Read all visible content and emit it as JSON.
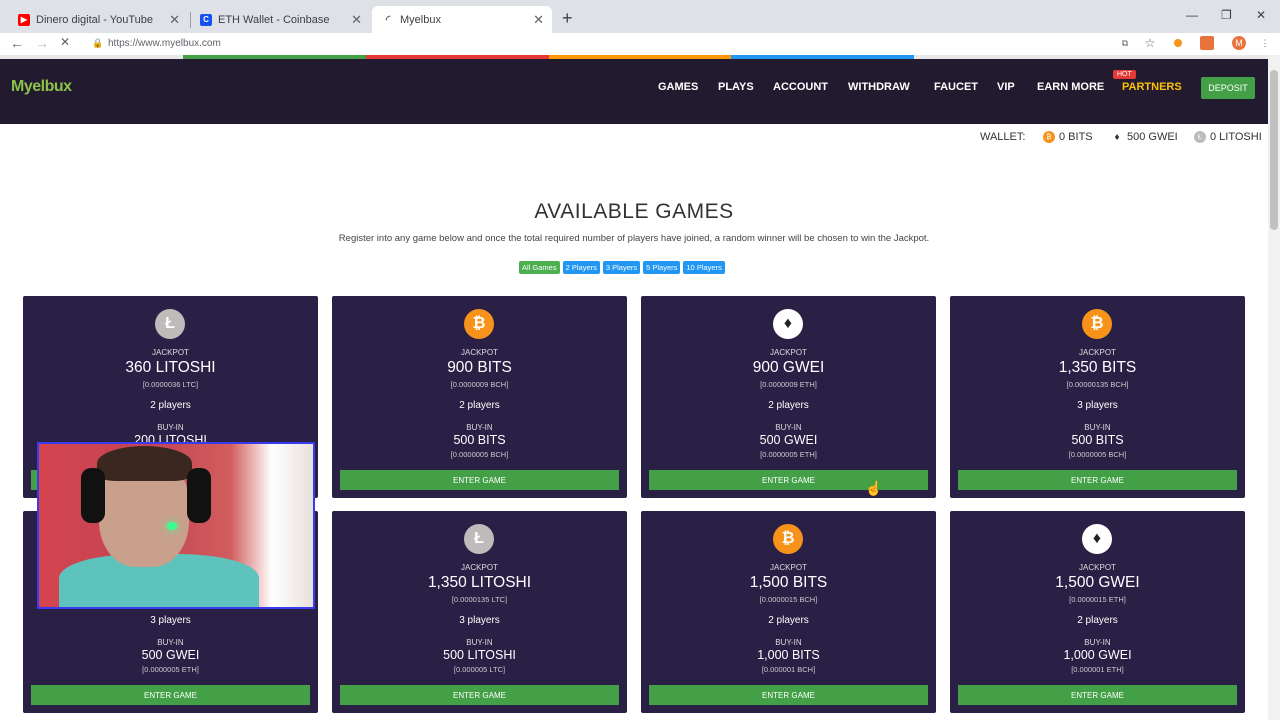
{
  "browser": {
    "tabs": [
      {
        "title": "Dinero digital - YouTube",
        "favicon_color": "#ff0000"
      },
      {
        "title": "ETH Wallet - Coinbase",
        "favicon_color": "#1652f0",
        "favicon_letter": "C"
      },
      {
        "title": "Myelbux",
        "loading": true
      }
    ],
    "url": "https://www.myelbux.com"
  },
  "header": {
    "logo": "Myelbux",
    "nav": [
      "GAMES",
      "PLAYS",
      "ACCOUNT",
      "WITHDRAW",
      "FAUCET",
      "VIP",
      "EARN MORE",
      "PARTNERS"
    ],
    "hot_badge": "HOT",
    "deposit": "DEPOSIT"
  },
  "wallet": {
    "label": "WALLET:",
    "bits": "0 BITS",
    "gwei": "500 GWEI",
    "litoshi": "0 LITOSHI"
  },
  "main": {
    "title": "AVAILABLE GAMES",
    "subtitle": "Register into any game below and once the total required number of players have joined, a random winner will be chosen to win the Jackpot.",
    "filters": [
      "All Games",
      "2 Players",
      "3 Players",
      "5 Players",
      "10 Players"
    ]
  },
  "cards": [
    {
      "coin": "ltc",
      "jackpot_label": "JACKPOT",
      "jackpot": "360 LITOSHI",
      "jackpot_sub": "[0.0000036 LTC]",
      "players": "2 players",
      "buyin_label": "BUY-IN",
      "buyin": "200 LITOSHI",
      "buyin_sub": "",
      "enter": "ENTER GAME"
    },
    {
      "coin": "btc",
      "jackpot_label": "JACKPOT",
      "jackpot": "900 BITS",
      "jackpot_sub": "[0.0000009 BCH]",
      "players": "2 players",
      "buyin_label": "BUY-IN",
      "buyin": "500 BITS",
      "buyin_sub": "[0.0000005 BCH]",
      "enter": "ENTER GAME"
    },
    {
      "coin": "eth",
      "jackpot_label": "JACKPOT",
      "jackpot": "900 GWEI",
      "jackpot_sub": "[0.0000009 ETH]",
      "players": "2 players",
      "buyin_label": "BUY-IN",
      "buyin": "500 GWEI",
      "buyin_sub": "[0.0000005 ETH]",
      "enter": "ENTER GAME"
    },
    {
      "coin": "btc",
      "jackpot_label": "JACKPOT",
      "jackpot": "1,350 BITS",
      "jackpot_sub": "[0.00000135 BCH]",
      "players": "3 players",
      "buyin_label": "BUY-IN",
      "buyin": "500 BITS",
      "buyin_sub": "[0.0000005 BCH]",
      "enter": "ENTER GAME"
    },
    {
      "coin": "eth",
      "jackpot_label": "",
      "jackpot": "",
      "jackpot_sub": "",
      "players": "3 players",
      "buyin_label": "BUY-IN",
      "buyin": "500 GWEI",
      "buyin_sub": "[0.0000005 ETH]",
      "enter": "ENTER GAME"
    },
    {
      "coin": "ltc",
      "jackpot_label": "JACKPOT",
      "jackpot": "1,350 LITOSHI",
      "jackpot_sub": "[0.0000135 LTC]",
      "players": "3 players",
      "buyin_label": "BUY-IN",
      "buyin": "500 LITOSHI",
      "buyin_sub": "[0.000005 LTC]",
      "enter": "ENTER GAME"
    },
    {
      "coin": "btc",
      "jackpot_label": "JACKPOT",
      "jackpot": "1,500 BITS",
      "jackpot_sub": "[0.0000015 BCH]",
      "players": "2 players",
      "buyin_label": "BUY-IN",
      "buyin": "1,000 BITS",
      "buyin_sub": "[0.000001 BCH]",
      "enter": "ENTER GAME"
    },
    {
      "coin": "eth",
      "jackpot_label": "JACKPOT",
      "jackpot": "1,500 GWEI",
      "jackpot_sub": "[0.0000015 ETH]",
      "players": "2 players",
      "buyin_label": "BUY-IN",
      "buyin": "1,000 GWEI",
      "buyin_sub": "[0.000001 ETH]",
      "enter": "ENTER GAME"
    }
  ],
  "colors": {
    "header_bg": "#221a2e",
    "card_bg": "#2a1f45",
    "accent_green": "#43a047",
    "logo_green": "#8bc34a",
    "partners_yellow": "#ffc107",
    "btc_orange": "#f7931a",
    "ltc_gray": "#bfbbbb",
    "eth_white": "#ffffff"
  }
}
